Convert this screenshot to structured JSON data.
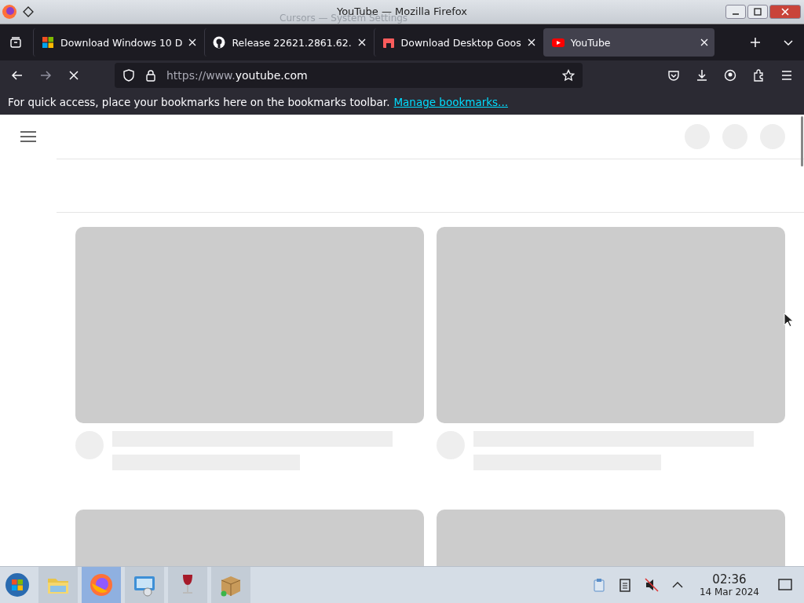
{
  "window": {
    "title": "YouTube — Mozilla Firefox",
    "background_title": "Cursors — System Settings"
  },
  "tabs": [
    {
      "label": "Download Windows 10 D",
      "kind": "windows",
      "selected": false
    },
    {
      "label": "Release 22621.2861.62.",
      "kind": "github",
      "selected": false
    },
    {
      "label": "Download Desktop Goos",
      "kind": "store",
      "selected": false
    },
    {
      "label": "YouTube",
      "kind": "youtube",
      "selected": true
    }
  ],
  "address": {
    "prefix": "https://www.",
    "domain": "youtube.com"
  },
  "bookmarks_bar": {
    "message": "For quick access, place your bookmarks here on the bookmarks toolbar.",
    "link": "Manage bookmarks..."
  },
  "taskbar": {
    "apps": [
      {
        "kind": "files",
        "selected": false
      },
      {
        "kind": "firefox",
        "selected": true
      },
      {
        "kind": "settings",
        "selected": false
      },
      {
        "kind": "wine",
        "selected": false
      },
      {
        "kind": "package",
        "selected": false
      }
    ],
    "time": "02:36",
    "date": "14 Mar 2024"
  }
}
